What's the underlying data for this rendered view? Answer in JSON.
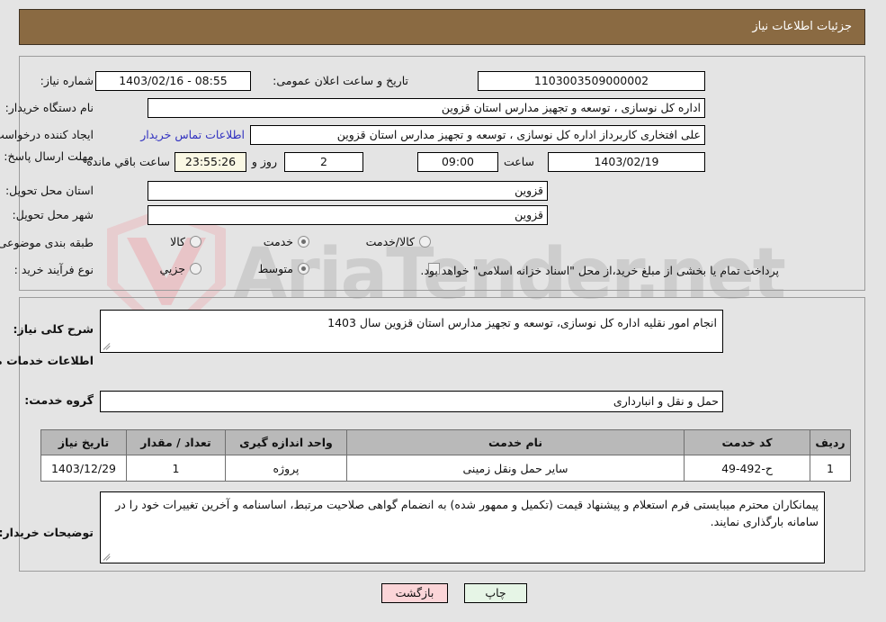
{
  "header": {
    "title": "جزئیات اطلاعات نیاز"
  },
  "top_form": {
    "need_number_label": "شماره نیاز:",
    "need_number_value": "1103003509000002",
    "public_announce_label": "تاریخ و ساعت اعلان عمومی:",
    "public_announce_value": "08:55 - 1403/02/16",
    "buyer_org_label": "نام دستگاه خریدار:",
    "buyer_org_value": "اداره کل نوسازی ، توسعه و تجهیز مدارس استان قزوین",
    "creator_label": "ایجاد کننده درخواست:",
    "creator_value": "علی افتخاری کاربرداز اداره کل نوسازی ، توسعه و تجهیز مدارس استان قزوین",
    "contact_link": "اطلاعات تماس خریدار",
    "deadline_label": "مهلت ارسال پاسخ: تا تاریخ:",
    "deadline_date": "1403/02/19",
    "deadline_hour_label": "ساعت",
    "deadline_hour_value": "09:00",
    "remaining_days_value": "2",
    "remaining_days_label": "روز و",
    "remaining_time_value": "23:55:26",
    "remaining_time_label": "ساعت باقي مانده",
    "province_label": "استان محل تحویل:",
    "province_value": "قزوین",
    "city_label": "شهر محل تحویل:",
    "city_value": "قزوین",
    "classification_label": "طبقه بندی موضوعی:",
    "classification_options": [
      {
        "label": "کالا",
        "selected": false
      },
      {
        "label": "خدمت",
        "selected": true
      },
      {
        "label": "کالا/خدمت",
        "selected": false
      }
    ],
    "process_label": "نوع فرآیند خرید :",
    "process_options": [
      {
        "label": "جزیي",
        "selected": false
      },
      {
        "label": "متوسط",
        "selected": true
      }
    ],
    "treasury_checkbox_label": "پرداخت تمام یا بخشی از مبلغ خرید،از محل \"اسناد خزانه اسلامی\" خواهد بود.",
    "treasury_checked": false
  },
  "middle": {
    "general_desc_label": "شرح کلی نیاز:",
    "general_desc_value": "انجام امور نقلیه اداره کل نوسازی، توسعه و تجهیز مدارس استان قزوین سال 1403",
    "services_section_title": "اطلاعات خدمات مورد نیاز",
    "service_group_label": "گروه خدمت:",
    "service_group_value": "حمل و نقل و انبارداری"
  },
  "table": {
    "columns": [
      "ردیف",
      "کد خدمت",
      "نام خدمت",
      "واحد اندازه گیری",
      "تعداد / مقدار",
      "تاریخ نیاز"
    ],
    "rows": [
      {
        "row": "1",
        "code": "ح-492-49",
        "name": "سایر حمل ونقل زمینی",
        "unit": "پروژه",
        "qty": "1",
        "date": "1403/12/29"
      }
    ]
  },
  "notes": {
    "label": "توضیحات خریدار:",
    "value": "پیمانکاران محترم میبایستی فرم استعلام و پیشنهاد قیمت (تکمیل و ممهور شده) به انضمام گواهی صلاحیت مرتبط، اساسنامه و آخرین تغییرات خود را در سامانه بارگذاری نمایند."
  },
  "buttons": {
    "print": "چاپ",
    "back": "بازگشت"
  },
  "watermark": {
    "text": "AriaTender.net"
  },
  "colors": {
    "header_bg": "#8a6a42",
    "page_bg": "#e4e4e4",
    "link": "#3131c0",
    "table_header_bg": "#b9b9b9",
    "print_btn_bg": "#e6f5e6",
    "back_btn_bg": "#fbd5d8",
    "countdown_bg": "#faf8e4"
  }
}
